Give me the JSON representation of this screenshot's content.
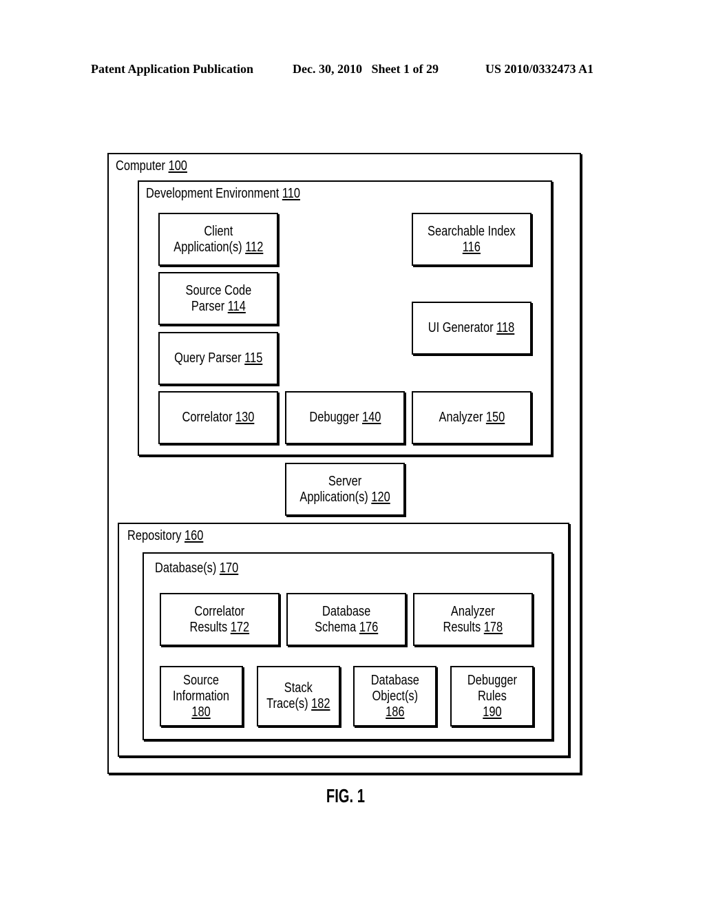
{
  "header": {
    "publication": "Patent Application Publication",
    "date_sheet": "Dec. 30, 2010   Sheet 1 of 29",
    "number": "US 2010/0332473 A1"
  },
  "diagram": {
    "computer": {
      "label": "Computer",
      "ref": "100"
    },
    "dev_env": {
      "label": "Development Environment",
      "ref": "110"
    },
    "client_app": {
      "line1": "Client",
      "line2": "Application(s)",
      "ref": "112"
    },
    "searchable_index": {
      "line1": "Searchable Index",
      "ref": "116"
    },
    "source_code_parser": {
      "line1": "Source Code",
      "line2": "Parser",
      "ref": "114"
    },
    "ui_generator": {
      "label": "UI Generator",
      "ref": "118"
    },
    "query_parser": {
      "label": "Query Parser",
      "ref": "115"
    },
    "correlator": {
      "label": "Correlator",
      "ref": "130"
    },
    "debugger": {
      "label": "Debugger",
      "ref": "140"
    },
    "analyzer": {
      "label": "Analyzer",
      "ref": "150"
    },
    "server_app": {
      "line1": "Server",
      "line2": "Application(s)",
      "ref": "120"
    },
    "repository": {
      "label": "Repository",
      "ref": "160"
    },
    "databases": {
      "label": "Database(s)",
      "ref": "170"
    },
    "correlator_results": {
      "line1": "Correlator",
      "line2": "Results",
      "ref": "172"
    },
    "database_schema": {
      "line1": "Database",
      "line2": "Schema",
      "ref": "176"
    },
    "analyzer_results": {
      "line1": "Analyzer",
      "line2": "Results",
      "ref": "178"
    },
    "source_information": {
      "line1": "Source",
      "line2": "Information",
      "ref": "180"
    },
    "stack_traces": {
      "line1": "Stack",
      "line2": "Trace(s)",
      "ref": "182"
    },
    "database_objects": {
      "line1": "Database",
      "line2": "Object(s)",
      "ref": "186"
    },
    "debugger_rules": {
      "line1": "Debugger",
      "line2": "Rules",
      "ref": "190"
    }
  },
  "figure_label": "FIG. 1"
}
